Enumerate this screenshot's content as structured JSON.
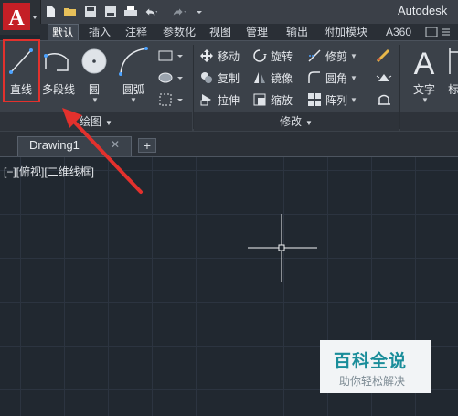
{
  "title_bar": {
    "app_title": "Autodesk",
    "app_menu_icon": "autocad-logo-icon",
    "quick_access": [
      "new-file-icon",
      "open-folder-icon",
      "save-icon",
      "save-as-icon",
      "print-icon",
      "undo-icon",
      "redo-icon"
    ]
  },
  "ribbon_tabs": [
    {
      "label": "默认",
      "active": true
    },
    {
      "label": "插入"
    },
    {
      "label": "注释"
    },
    {
      "label": "参数化"
    },
    {
      "label": "视图"
    },
    {
      "label": "管理"
    },
    {
      "label": "输出"
    },
    {
      "label": "附加模块"
    },
    {
      "label": "A360"
    }
  ],
  "draw_panel": {
    "title": "绘图",
    "buttons": {
      "line": "直线",
      "polyline": "多段线",
      "circle": "圆",
      "arc": "圆弧"
    }
  },
  "modify_panel": {
    "title": "修改",
    "buttons": {
      "move": "移动",
      "rotate": "旋转",
      "trim": "修剪",
      "copy": "复制",
      "mirror": "镜像",
      "fillet": "圆角",
      "stretch": "拉伸",
      "scale": "缩放",
      "array": "阵列"
    }
  },
  "annotation_panel": {
    "buttons": {
      "text": "文字",
      "dimension_partial": "标"
    }
  },
  "document": {
    "tab_label": "Drawing1",
    "viewport_label": "[−][俯视][二维线框]"
  },
  "watermark": {
    "title": "百科全说",
    "subtitle": "助你轻松解决"
  },
  "colors": {
    "canvas_bg": "#212830",
    "ribbon_bg": "#3b4149",
    "highlight": "#e3312d",
    "arrow": "#e3312d"
  }
}
